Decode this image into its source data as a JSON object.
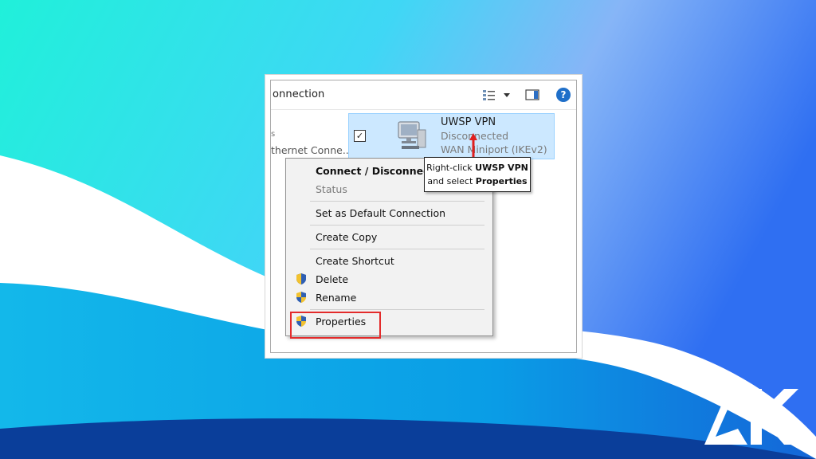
{
  "window": {
    "title_fragment": "onnection"
  },
  "left_item": {
    "label_fragment": "thernet Conne..."
  },
  "vpn_item": {
    "name": "UWSP VPN",
    "status": "Disconnected",
    "device": "WAN Miniport (IKEv2)"
  },
  "context_menu": {
    "items": [
      {
        "label": "Connect / Disconnect"
      },
      {
        "label": "Status"
      },
      {
        "label": "Set as Default Connection"
      },
      {
        "label": "Create Copy"
      },
      {
        "label": "Create Shortcut"
      },
      {
        "label": "Delete"
      },
      {
        "label": "Rename"
      },
      {
        "label": "Properties"
      }
    ]
  },
  "callout": {
    "line1_prefix": "Right-click ",
    "line1_bold": "UWSP VPN",
    "line2_prefix": "and select ",
    "line2_bold": "Properties"
  },
  "colors": {
    "bg_cyan": "#1fe4d6",
    "bg_blue": "#2f7cf0",
    "wave_blue": "#0aa2e8",
    "selection": "#cce8ff",
    "highlight_red": "#e32b2b"
  },
  "icons": [
    "view-options-icon",
    "dropdown-arrow-icon",
    "preview-pane-icon",
    "help-icon",
    "computer-network-icon",
    "checkbox-checked-icon",
    "uac-shield-icon",
    "red-arrow-icon",
    "ak-logo"
  ]
}
